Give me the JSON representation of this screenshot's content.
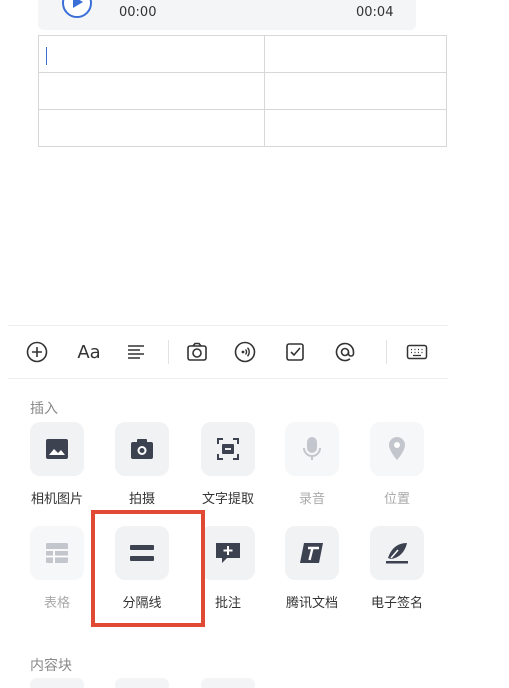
{
  "audio": {
    "start_time": "00:00",
    "end_time": "00:04"
  },
  "table": {
    "rows": [
      [
        "",
        ""
      ],
      [
        "",
        ""
      ],
      [
        "",
        ""
      ]
    ]
  },
  "toolbar": {
    "font_button_label": "Aa",
    "icons": [
      "plus-circle-icon",
      "font-icon",
      "align-icon",
      "camera-icon",
      "audio-icon",
      "checkbox-icon",
      "at-icon",
      "keyboard-icon"
    ]
  },
  "panel": {
    "insert_title": "插入",
    "insert_row1": [
      {
        "label": "相机图片",
        "icon": "image-icon",
        "enabled": true
      },
      {
        "label": "拍摄",
        "icon": "camera-icon",
        "enabled": true
      },
      {
        "label": "文字提取",
        "icon": "text-scan-icon",
        "enabled": true
      },
      {
        "label": "录音",
        "icon": "microphone-icon",
        "enabled": false
      },
      {
        "label": "位置",
        "icon": "location-icon",
        "enabled": false
      }
    ],
    "insert_row2": [
      {
        "label": "表格",
        "icon": "table-icon",
        "enabled": false
      },
      {
        "label": "分隔线",
        "icon": "divider-icon",
        "enabled": true
      },
      {
        "label": "批注",
        "icon": "comment-add-icon",
        "enabled": true
      },
      {
        "label": "腾讯文档",
        "icon": "tencent-docs-icon",
        "enabled": true
      },
      {
        "label": "电子签名",
        "icon": "signature-icon",
        "enabled": true
      }
    ],
    "content_block_title": "内容块"
  },
  "colors": {
    "accent": "#3a6fd8",
    "highlight": "#e04a35",
    "icon_dark": "#3c4250",
    "icon_disabled": "#c3c6cc"
  }
}
